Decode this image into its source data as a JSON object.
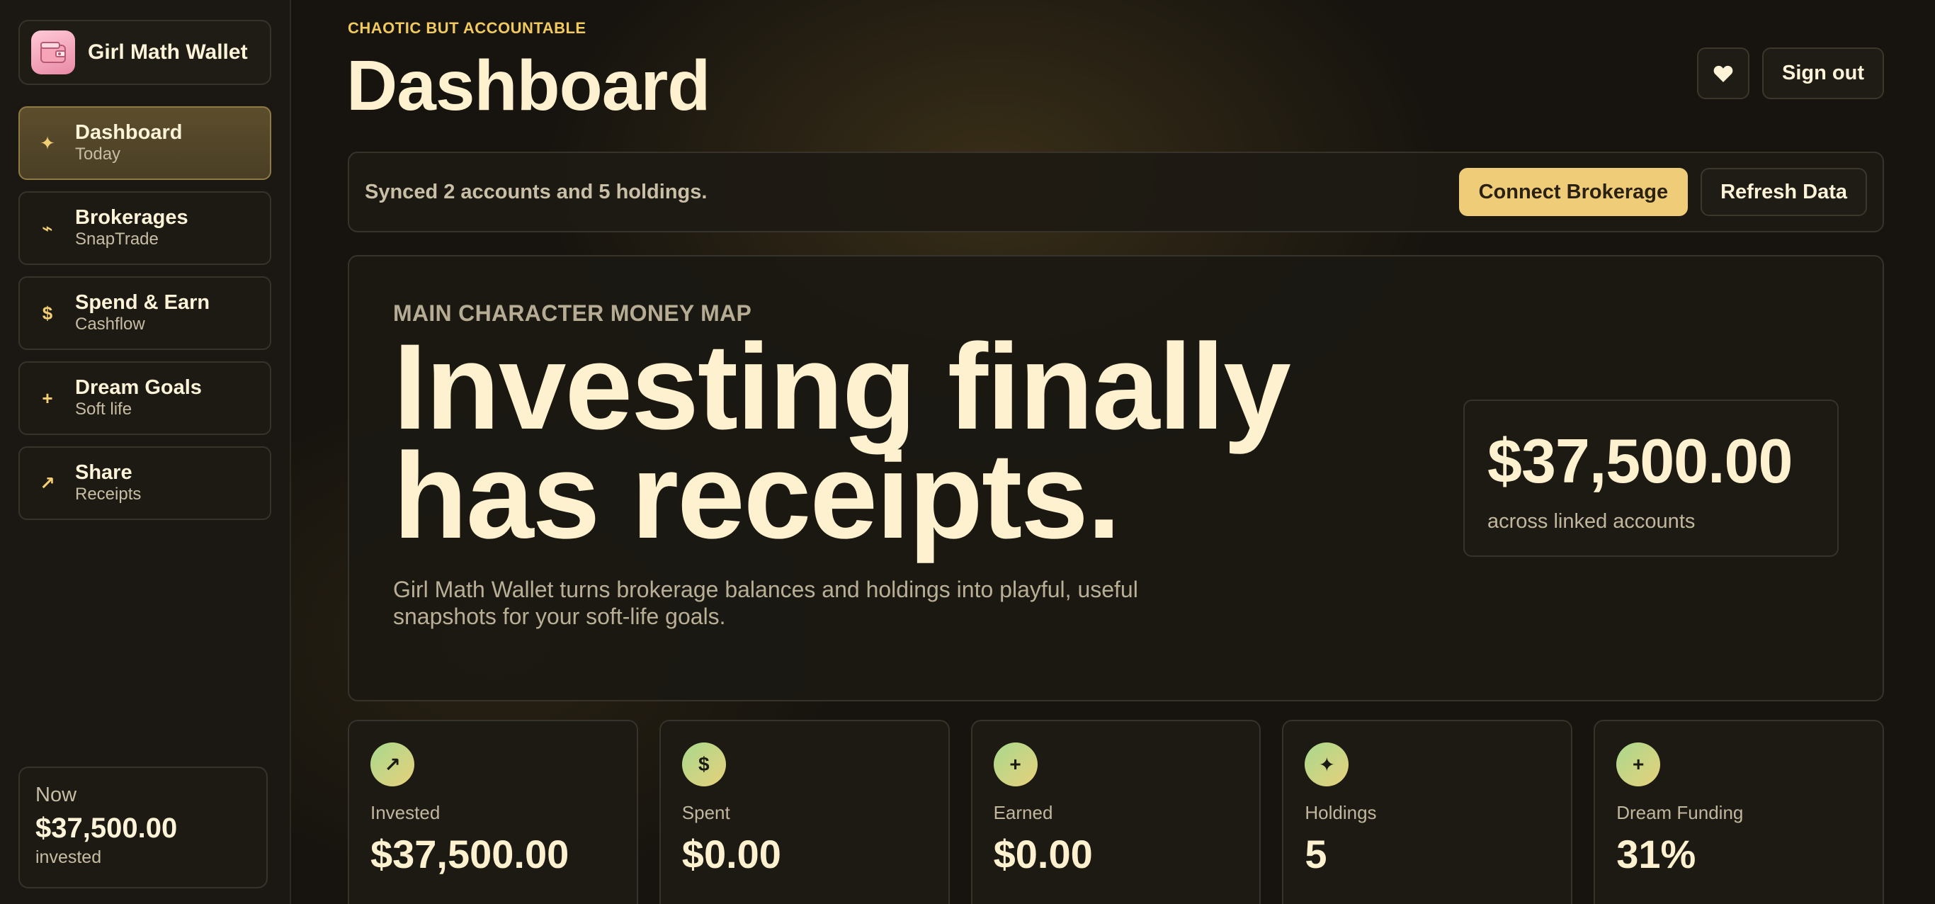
{
  "brand": {
    "name": "Girl Math Wallet",
    "logo_icon": "wallet-icon"
  },
  "sidebar": {
    "items": [
      {
        "label": "Dashboard",
        "sub": "Today",
        "icon": "sparkle-icon",
        "glyph": "✦",
        "active": true
      },
      {
        "label": "Brokerages",
        "sub": "SnapTrade",
        "icon": "link-icon",
        "glyph": "⌁",
        "active": false
      },
      {
        "label": "Spend & Earn",
        "sub": "Cashflow",
        "icon": "dollar-icon",
        "glyph": "$",
        "active": false
      },
      {
        "label": "Dream Goals",
        "sub": "Soft life",
        "icon": "plus-icon",
        "glyph": "+",
        "active": false
      },
      {
        "label": "Share",
        "sub": "Receipts",
        "icon": "arrow-up-right-icon",
        "glyph": "↗",
        "active": false
      }
    ],
    "now": {
      "label": "Now",
      "value": "$37,500.00",
      "sub": "invested"
    }
  },
  "header": {
    "eyebrow": "CHAOTIC BUT ACCOUNTABLE",
    "title": "Dashboard",
    "favorite_icon": "heart-icon",
    "sign_out_label": "Sign out"
  },
  "sync": {
    "text": "Synced 2 accounts and 5 holdings.",
    "connect_label": "Connect Brokerage",
    "refresh_label": "Refresh Data"
  },
  "hero": {
    "eyebrow": "MAIN CHARACTER MONEY MAP",
    "title": "Investing finally has receipts.",
    "description": "Girl Math Wallet turns brokerage balances and holdings into playful, useful snapshots for your soft-life goals.",
    "total_value": "$37,500.00",
    "total_sub": "across linked accounts"
  },
  "stats": [
    {
      "label": "Invested",
      "value": "$37,500.00",
      "icon": "arrow-up-right-icon",
      "glyph": "↗"
    },
    {
      "label": "Spent",
      "value": "$0.00",
      "icon": "dollar-icon",
      "glyph": "$"
    },
    {
      "label": "Earned",
      "value": "$0.00",
      "icon": "plus-icon",
      "glyph": "+"
    },
    {
      "label": "Holdings",
      "value": "5",
      "icon": "sparkle-icon",
      "glyph": "✦"
    },
    {
      "label": "Dream Funding",
      "value": "31%",
      "icon": "plus-icon",
      "glyph": "+"
    }
  ],
  "colors": {
    "accent": "#efcc78",
    "background": "#17140f",
    "text": "#fdf1cf"
  }
}
